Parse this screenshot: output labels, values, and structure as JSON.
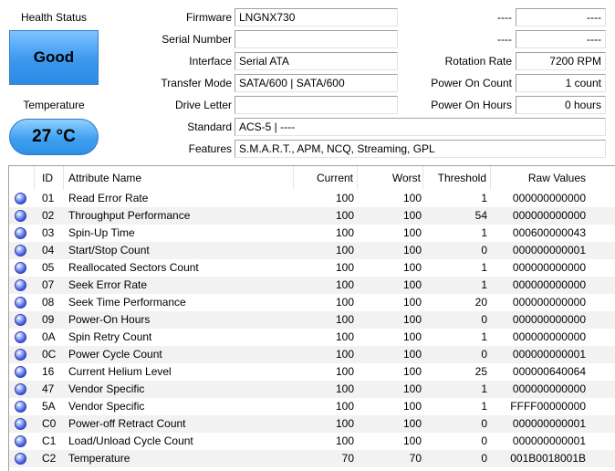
{
  "health": {
    "title": "Health Status",
    "value": "Good"
  },
  "temperature": {
    "title": "Temperature",
    "value": "27 °C"
  },
  "info_left": [
    {
      "label": "Firmware",
      "value": "LNGNX730"
    },
    {
      "label": "Serial Number",
      "value": ""
    },
    {
      "label": "Interface",
      "value": "Serial ATA"
    },
    {
      "label": "Transfer Mode",
      "value": "SATA/600 | SATA/600"
    },
    {
      "label": "Drive Letter",
      "value": ""
    }
  ],
  "info_right": [
    {
      "label": "----",
      "value": "----"
    },
    {
      "label": "----",
      "value": "----"
    },
    {
      "label": "Rotation Rate",
      "value": "7200 RPM"
    },
    {
      "label": "Power On Count",
      "value": "1 count"
    },
    {
      "label": "Power On Hours",
      "value": "0 hours"
    }
  ],
  "standard": {
    "label": "Standard",
    "value": "ACS-5 | ----"
  },
  "features": {
    "label": "Features",
    "value": "S.M.A.R.T., APM, NCQ, Streaming, GPL"
  },
  "table": {
    "headers": {
      "id": "ID",
      "name": "Attribute Name",
      "current": "Current",
      "worst": "Worst",
      "threshold": "Threshold",
      "raw": "Raw Values"
    },
    "rows": [
      {
        "id": "01",
        "name": "Read Error Rate",
        "current": "100",
        "worst": "100",
        "threshold": "1",
        "raw": "000000000000"
      },
      {
        "id": "02",
        "name": "Throughput Performance",
        "current": "100",
        "worst": "100",
        "threshold": "54",
        "raw": "000000000000"
      },
      {
        "id": "03",
        "name": "Spin-Up Time",
        "current": "100",
        "worst": "100",
        "threshold": "1",
        "raw": "000600000043"
      },
      {
        "id": "04",
        "name": "Start/Stop Count",
        "current": "100",
        "worst": "100",
        "threshold": "0",
        "raw": "000000000001"
      },
      {
        "id": "05",
        "name": "Reallocated Sectors Count",
        "current": "100",
        "worst": "100",
        "threshold": "1",
        "raw": "000000000000"
      },
      {
        "id": "07",
        "name": "Seek Error Rate",
        "current": "100",
        "worst": "100",
        "threshold": "1",
        "raw": "000000000000"
      },
      {
        "id": "08",
        "name": "Seek Time Performance",
        "current": "100",
        "worst": "100",
        "threshold": "20",
        "raw": "000000000000"
      },
      {
        "id": "09",
        "name": "Power-On Hours",
        "current": "100",
        "worst": "100",
        "threshold": "0",
        "raw": "000000000000"
      },
      {
        "id": "0A",
        "name": "Spin Retry Count",
        "current": "100",
        "worst": "100",
        "threshold": "1",
        "raw": "000000000000"
      },
      {
        "id": "0C",
        "name": "Power Cycle Count",
        "current": "100",
        "worst": "100",
        "threshold": "0",
        "raw": "000000000001"
      },
      {
        "id": "16",
        "name": "Current Helium Level",
        "current": "100",
        "worst": "100",
        "threshold": "25",
        "raw": "000000640064"
      },
      {
        "id": "47",
        "name": "Vendor Specific",
        "current": "100",
        "worst": "100",
        "threshold": "1",
        "raw": "000000000000"
      },
      {
        "id": "5A",
        "name": "Vendor Specific",
        "current": "100",
        "worst": "100",
        "threshold": "1",
        "raw": "FFFF00000000"
      },
      {
        "id": "C0",
        "name": "Power-off Retract Count",
        "current": "100",
        "worst": "100",
        "threshold": "0",
        "raw": "000000000001"
      },
      {
        "id": "C1",
        "name": "Load/Unload Cycle Count",
        "current": "100",
        "worst": "100",
        "threshold": "0",
        "raw": "000000000001"
      },
      {
        "id": "C2",
        "name": "Temperature",
        "current": "70",
        "worst": "70",
        "threshold": "0",
        "raw": "001B0018001B"
      }
    ]
  },
  "colors": {
    "good": "#3a98ee",
    "status_dot": "#4a5fe0"
  }
}
